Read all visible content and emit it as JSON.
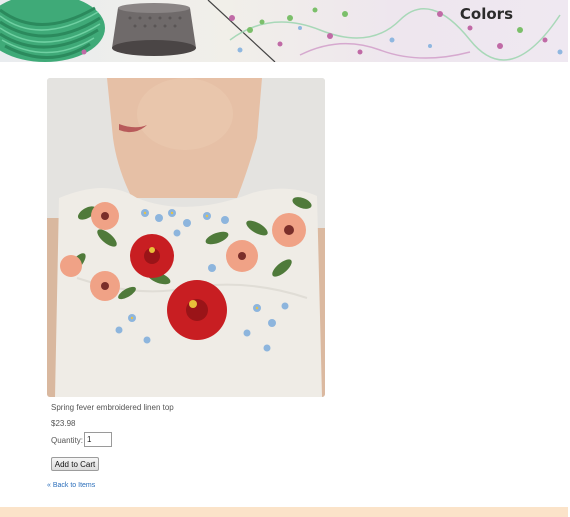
{
  "header": {
    "title": "Colors"
  },
  "product": {
    "image_subject": "embroidered-linen-top-photo",
    "name": "Spring fever embroidered linen top",
    "price": "$23.98",
    "quantity_label": "Quantity:",
    "quantity_value": "1",
    "add_to_cart_label": "Add to Cart"
  },
  "nav": {
    "back_label": "« Back to Items"
  },
  "colors": {
    "link": "#2a6ebb",
    "footer_bar": "#fbe3c9"
  }
}
